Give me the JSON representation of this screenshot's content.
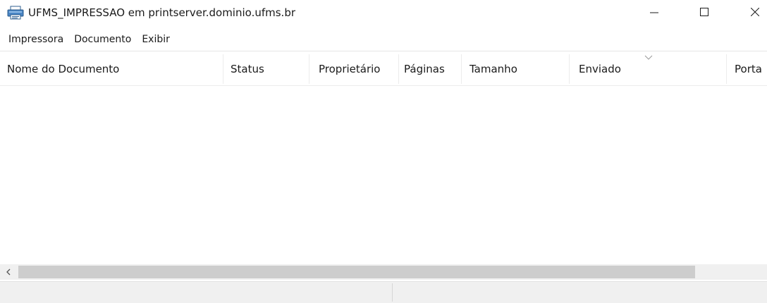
{
  "window": {
    "title": "UFMS_IMPRESSAO em printserver.dominio.ufms.br",
    "icon": "printer-icon",
    "controls": [
      "minimize-icon",
      "maximize-icon",
      "close-icon"
    ]
  },
  "menu": {
    "items": [
      {
        "label": "Impressora"
      },
      {
        "label": "Documento"
      },
      {
        "label": "Exibir"
      }
    ]
  },
  "columns": [
    {
      "label": "Nome do Documento"
    },
    {
      "label": "Status"
    },
    {
      "label": "Proprietário"
    },
    {
      "label": "Páginas"
    },
    {
      "label": "Tamanho"
    },
    {
      "label": "Enviado",
      "sorted": true
    },
    {
      "label": "Porta"
    }
  ],
  "rows": [],
  "statusbar": {
    "left": "",
    "right": ""
  },
  "colors": {
    "background": "#ffffff",
    "chrome": "#f0f0f0",
    "scroll_thumb": "#cdcdcd"
  }
}
